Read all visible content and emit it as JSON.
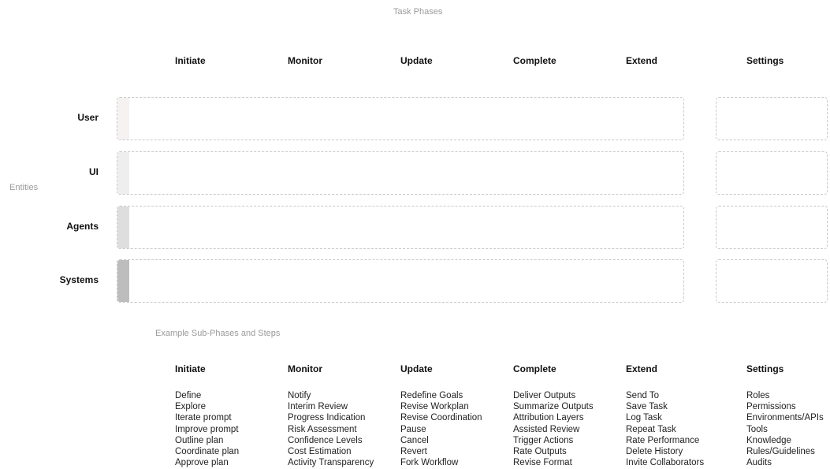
{
  "title": "Task Phases",
  "entities_label": "Entities",
  "columns": [
    "Initiate",
    "Monitor",
    "Update",
    "Complete",
    "Extend",
    "Settings"
  ],
  "rows": [
    {
      "label": "User",
      "tab_color": "#f7f2f2"
    },
    {
      "label": "UI",
      "tab_color": "#eeeeee"
    },
    {
      "label": "Agents",
      "tab_color": "#dedede"
    },
    {
      "label": "Systems",
      "tab_color": "#bdbdbd"
    }
  ],
  "examples": {
    "title": "Example Sub-Phases  and Steps",
    "columns": [
      {
        "heading": "Initiate",
        "steps": [
          "Define",
          "Explore",
          "Iterate prompt",
          "Improve prompt",
          "Outline plan",
          "Coordinate plan",
          "Approve plan"
        ]
      },
      {
        "heading": "Monitor",
        "steps": [
          "Notify",
          "Interim Review",
          "Progress Indication",
          "Risk Assessment",
          "Confidence Levels",
          "Cost Estimation",
          "Activity Transparency"
        ]
      },
      {
        "heading": "Update",
        "steps": [
          "Redefine Goals",
          "Revise Workplan",
          "Revise Coordination",
          "Pause",
          "Cancel",
          "Revert",
          "Fork Workflow"
        ]
      },
      {
        "heading": "Complete",
        "steps": [
          "Deliver Outputs",
          "Summarize Outputs",
          "Attribution Layers",
          "Assisted Review",
          "Trigger Actions",
          "Rate Outputs",
          "Revise Format"
        ]
      },
      {
        "heading": "Extend",
        "steps": [
          "Send To",
          "Save Task",
          "Log Task",
          "Repeat Task",
          "Rate Performance",
          "Delete History",
          "Invite Collaborators"
        ]
      },
      {
        "heading": "Settings",
        "steps": [
          "Roles",
          "Permissions",
          "Environments/APIs",
          "Tools",
          "Knowledge",
          "Rules/Guidelines",
          "Audits"
        ]
      }
    ]
  }
}
